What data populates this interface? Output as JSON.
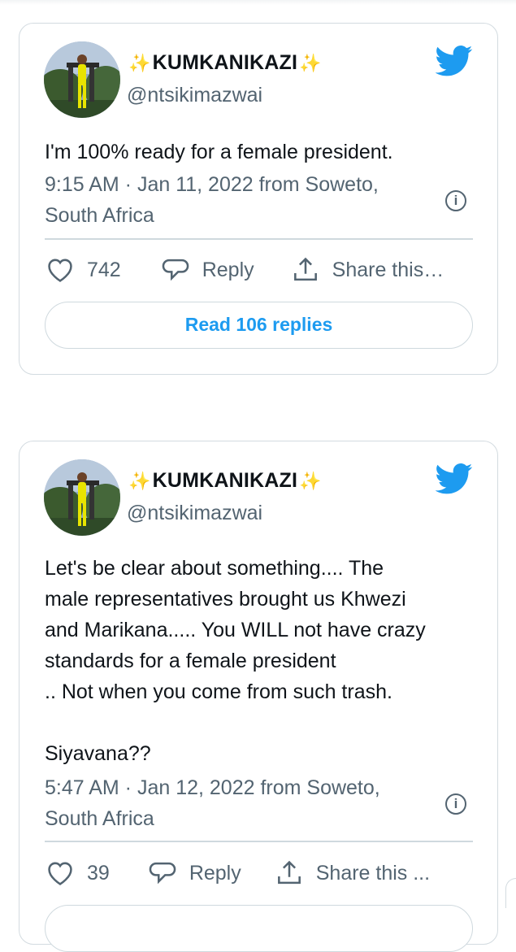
{
  "tweets": [
    {
      "display_name": "KUMKANIKAZI",
      "handle": "@ntsikimazwai",
      "text_lines": [
        "I'm 100% ready for a female president."
      ],
      "meta_lines": [
        "9:15 AM · Jan 11, 2022 from Soweto,",
        "South Africa"
      ],
      "likes": "742",
      "reply_label": "Reply",
      "share_label": "Share this…",
      "read_replies_label": "Read 106 replies"
    },
    {
      "display_name": "KUMKANIKAZI",
      "handle": "@ntsikimazwai",
      "text_lines": [
        "Let's be clear about something.... The",
        "male representatives brought us Khwezi",
        "and Marikana..... You WILL not have crazy",
        "standards for a female president",
        ".. Not when you come from such trash.",
        "",
        "Siyavana??"
      ],
      "meta_lines": [
        "5:47 AM · Jan 12, 2022 from Soweto,",
        "South Africa"
      ],
      "likes": "39",
      "reply_label": "Reply",
      "share_label": "Share this ..."
    }
  ],
  "icons": {
    "sparkle": "sparkle-icon",
    "bird": "twitter-bird-icon",
    "info": "info-icon",
    "like": "heart-icon",
    "reply": "speech-bubble-icon",
    "share": "share-icon"
  },
  "colors": {
    "accent": "#1d9bf0",
    "text": "#0f1419",
    "muted": "#536471",
    "border": "#d3dbe0",
    "sparkle": "#f7b924"
  }
}
